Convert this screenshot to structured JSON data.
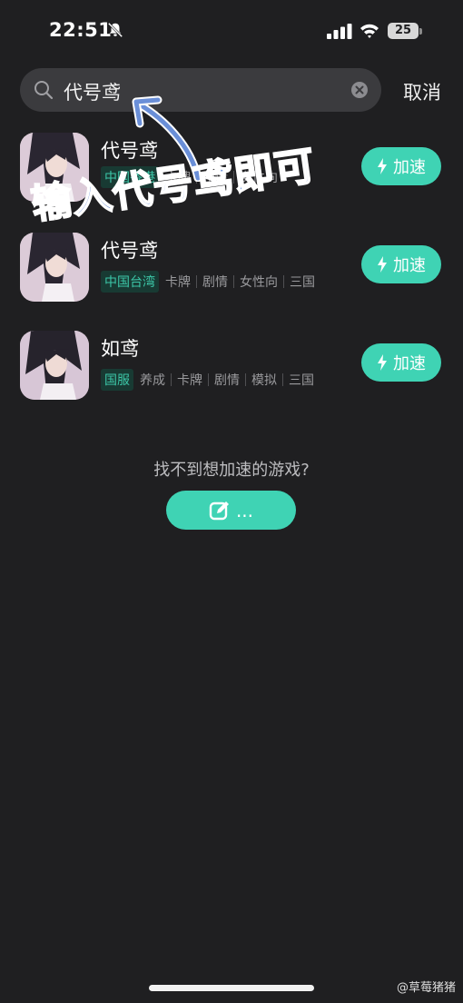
{
  "status_bar": {
    "time": "22:51",
    "battery": "25",
    "icons": [
      "bell-muted-icon",
      "cellular-signal-icon",
      "wifi-icon",
      "battery-icon"
    ]
  },
  "search": {
    "value": "代号鸢",
    "cancel_label": "取消",
    "icons": [
      "search-icon",
      "clear-icon"
    ]
  },
  "results": [
    {
      "name": "代号鸢",
      "region": "中国香港",
      "tags": [
        "卡牌",
        "剧情",
        "女性向"
      ],
      "button": "加速"
    },
    {
      "name": "代号鸢",
      "region": "中国台湾",
      "tags": [
        "卡牌",
        "剧情",
        "女性向",
        "三国"
      ],
      "button": "加速"
    },
    {
      "name": "如鸢",
      "region": "国服",
      "tags": [
        "养成",
        "卡牌",
        "剧情",
        "模拟",
        "三国"
      ],
      "button": "加速"
    }
  ],
  "footer": {
    "not_found_text": "找不到想加速的游戏?",
    "feedback_label": "..."
  },
  "annotation": {
    "text": "输入代号鸢即可"
  },
  "watermark": "@草莓猪猪",
  "colors": {
    "background": "#1f1f21",
    "accent": "#3fd3b4",
    "region_tag_text": "#3cc7a8",
    "annotation": "#6a8fd8"
  }
}
